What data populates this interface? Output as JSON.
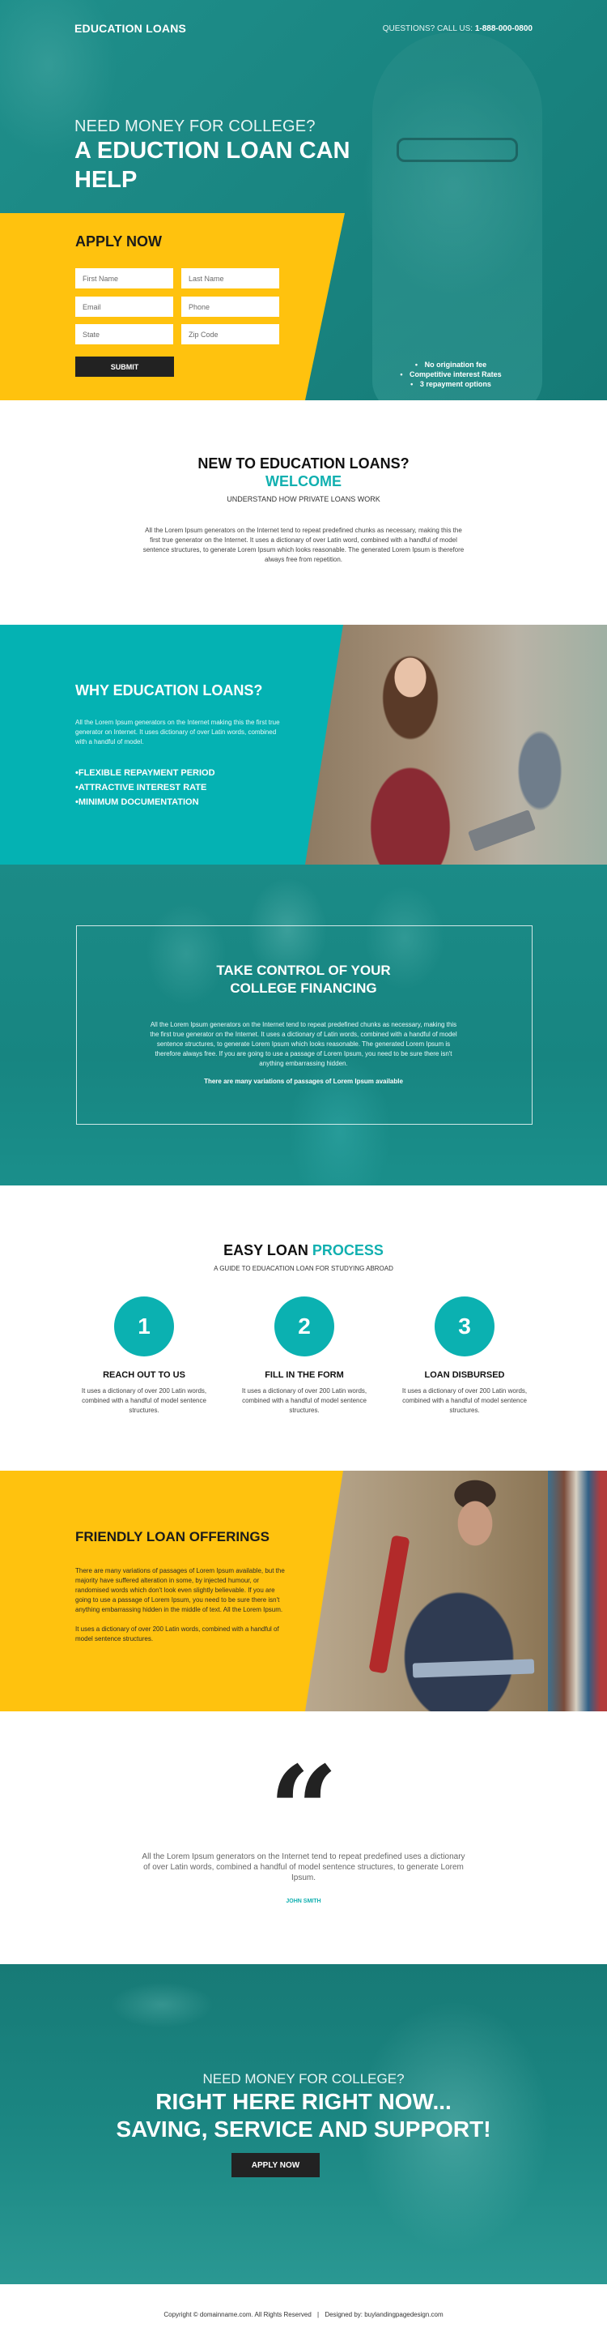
{
  "colors": {
    "teal_dark": "#1b8b87",
    "teal_accent": "#0bb1b1",
    "yellow": "#ffc20e",
    "dark_button": "#222222"
  },
  "header": {
    "brand": "EDUCATION LOANS",
    "call_label": "QUESTIONS? CALL US:",
    "phone": "1-888-000-0800"
  },
  "hero": {
    "subtitle": "NEED MONEY FOR COLLEGE?",
    "title": "A EDUCTION LOAN CAN HELP",
    "form": {
      "title": "APPLY NOW",
      "fields": [
        {
          "placeholder": "First Name",
          "value": ""
        },
        {
          "placeholder": "Last Name",
          "value": ""
        },
        {
          "placeholder": "Email",
          "value": ""
        },
        {
          "placeholder": "Phone",
          "value": ""
        },
        {
          "placeholder": "State",
          "value": ""
        },
        {
          "placeholder": "Zip Code",
          "value": ""
        }
      ],
      "submit_label": "SUBMIT"
    },
    "bullets": [
      "No origination fee",
      "Competitive interest Rates",
      "3 repayment options"
    ]
  },
  "welcome": {
    "title": "NEW TO EDUCATION LOANS?",
    "highlight": "WELCOME",
    "subtitle": "UNDERSTAND HOW PRIVATE LOANS WORK",
    "body": "All the Lorem Ipsum generators on the Internet tend to repeat predefined chunks as necessary, making this the first true generator on the Internet. It uses a dictionary of over Latin word, combined with a handful of model sentence structures, to generate Lorem Ipsum which looks reasonable. The generated Lorem Ipsum is therefore always free from repetition."
  },
  "why": {
    "title": "WHY EDUCATION LOANS?",
    "body": "All the Lorem Ipsum generators on the Internet making this the first true generator on Internet. It uses dictionary of over Latin words, combined with a handful of model.",
    "items": [
      "FLEXIBLE REPAYMENT PERIOD",
      "ATTRACTIVE INTEREST RATE",
      "MINIMUM DOCUMENTATION"
    ]
  },
  "control": {
    "title_line1": "TAKE CONTROL OF YOUR",
    "title_line2": "COLLEGE FINANCING",
    "body": "All the Lorem Ipsum generators on the Internet tend to repeat predefined chunks as necessary, making this the first true generator on the Internet. It uses a dictionary of Latin words, combined with a handful of model sentence structures, to generate Lorem Ipsum which looks reasonable. The generated Lorem Ipsum is therefore always free. If you are going to use a passage of Lorem Ipsum, you need to be sure there isn't anything embarrassing hidden.",
    "strong": "There are many variations of passages of Lorem Ipsum available"
  },
  "process": {
    "title": "EASY LOAN",
    "title_accent": "PROCESS",
    "subtitle": "A GUIDE TO EDUACATION LOAN FOR STUDYING ABROAD",
    "steps": [
      {
        "number": "1",
        "title": "REACH OUT TO US",
        "body": "It uses a dictionary of over 200 Latin words, combined with a handful of model sentence structures."
      },
      {
        "number": "2",
        "title": "FILL IN THE FORM",
        "body": "It uses a dictionary of over 200 Latin words, combined with a handful of model sentence structures."
      },
      {
        "number": "3",
        "title": "LOAN DISBURSED",
        "body": "It uses a dictionary of over 200 Latin words, combined with a handful of model sentence structures."
      }
    ]
  },
  "friendly": {
    "title": "FRIENDLY LOAN OFFERINGS",
    "paragraph1": "There are many variations of passages of Lorem Ipsum available, but the majority have suffered alteration in some, by injected humour, or randomised words which don't look even slightly believable. If you are going to use a passage of Lorem Ipsum, you need to be sure there isn't anything embarrassing hidden in the middle of text. All the Lorem Ipsum.",
    "paragraph2": "It uses a dictionary of over 200 Latin words, combined with a handful of model sentence structures."
  },
  "testimonial": {
    "quote_glyph": "“",
    "text": "All the Lorem Ipsum generators on the Internet tend to repeat predefined uses a dictionary of over Latin words, combined a handful of model sentence structures, to generate Lorem Ipsum.",
    "author": "JOHN SMITH"
  },
  "cta": {
    "subtitle": "NEED MONEY FOR COLLEGE?",
    "title_line1": "RIGHT HERE RIGHT NOW...",
    "title_line2": "SAVING, SERVICE AND SUPPORT!",
    "button_label": "APPLY NOW"
  },
  "footer": {
    "copyright": "Copyright © domainname.com. All Rights Reserved",
    "separator": "|",
    "designed_by": "Designed by: buylandingpagedesign.com"
  }
}
